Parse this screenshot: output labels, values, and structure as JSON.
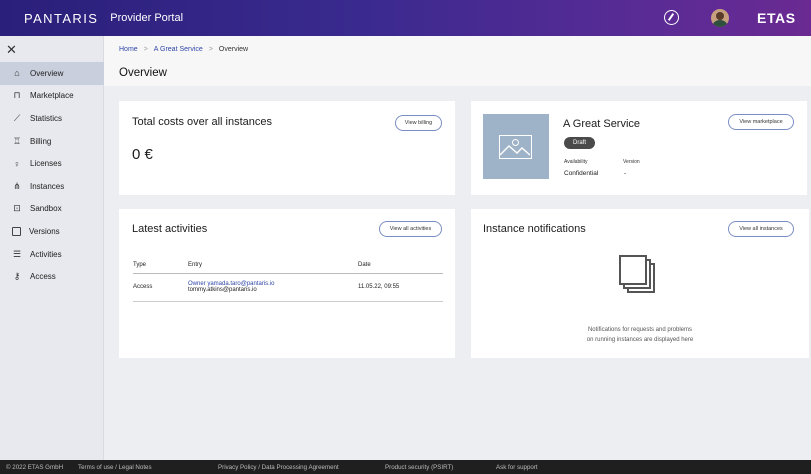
{
  "header": {
    "brand": "PANTARIS",
    "portal": "Provider Portal",
    "logo": "ETAS",
    "icons": [
      "compass-icon",
      "avatar"
    ]
  },
  "sidebar": {
    "close_icon": "close-icon",
    "items": [
      {
        "label": "Overview",
        "icon": "home-icon",
        "active": true
      },
      {
        "label": "Marketplace",
        "icon": "bag-icon"
      },
      {
        "label": "Statistics",
        "icon": "chart-icon"
      },
      {
        "label": "Billing",
        "icon": "billing-icon"
      },
      {
        "label": "Licenses",
        "icon": "license-icon"
      },
      {
        "label": "Instances",
        "icon": "instances-icon"
      },
      {
        "label": "Sandbox",
        "icon": "sandbox-icon"
      },
      {
        "label": "Versions",
        "icon": "versions-icon"
      },
      {
        "label": "Activities",
        "icon": "activities-icon"
      },
      {
        "label": "Access",
        "icon": "access-icon"
      }
    ]
  },
  "breadcrumb": {
    "home": "Home",
    "service": "A Great Service",
    "current": "Overview"
  },
  "page": {
    "title": "Overview"
  },
  "costs": {
    "title": "Total costs over all instances",
    "button": "View billing",
    "value": "0 €"
  },
  "service": {
    "title": "A Great Service",
    "status": "Draft",
    "button": "View marketplace",
    "availability_label": "Availability",
    "availability_value": "Confidential",
    "version_label": "Version",
    "version_value": "-"
  },
  "activities": {
    "title": "Latest activities",
    "button": "View all activities",
    "columns": [
      "Type",
      "Entry",
      "Date"
    ],
    "rows": [
      {
        "type": "Access",
        "entry_link": "Owner yamada.taro@pantaris.io",
        "entry_text": "tommy.atkins@pantaris.io",
        "date": "11.05.22, 09:55"
      }
    ]
  },
  "notifications": {
    "title": "Instance notifications",
    "button": "View all instances",
    "line1": "Notifications for requests and problems",
    "line2": "on running instances are displayed here"
  },
  "footer": {
    "copyright": "© 2022 ETAS GmbH",
    "terms": "Terms of use / Legal Notes",
    "privacy": "Privacy Policy / Data Processing Agreement",
    "security": "Product security (PSIRT)",
    "support": "Ask for support"
  },
  "colors": {
    "header_start": "#2a1f7a",
    "header_end": "#6a2a92",
    "link": "#3046a8",
    "active_nav": "#c9cfdc"
  }
}
